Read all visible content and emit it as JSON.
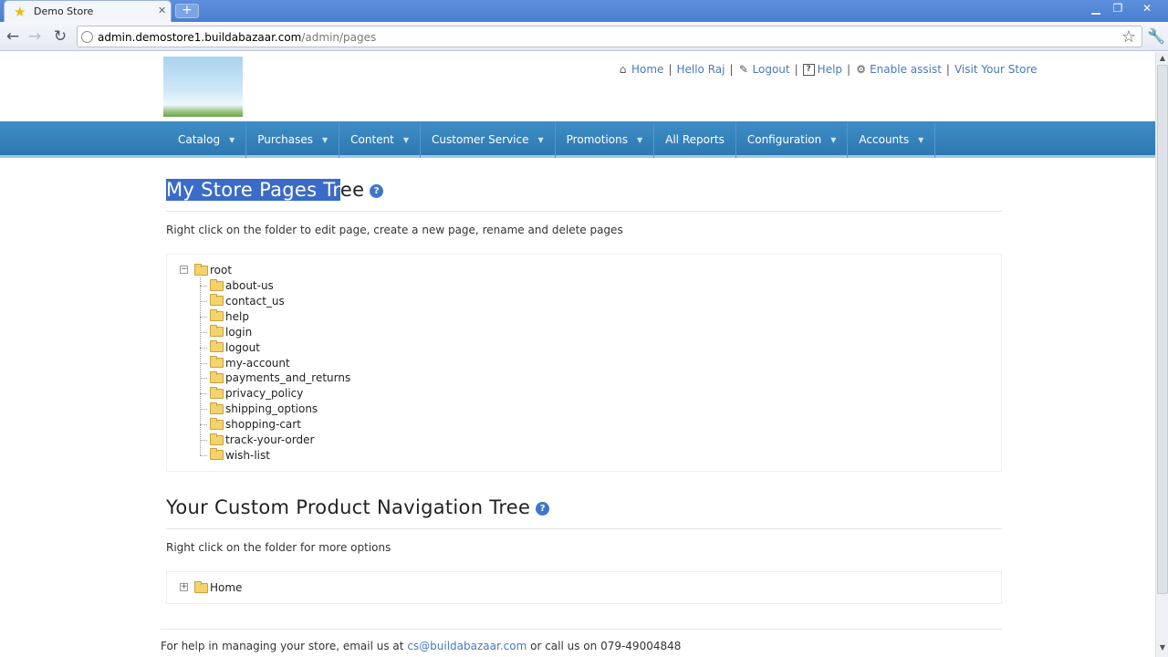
{
  "browser": {
    "tab_title": "Demo Store",
    "url_host": "admin.demostore1.buildabazaar.com",
    "url_path": "/admin/pages"
  },
  "header": {
    "links": {
      "home": "Home",
      "hello": "Hello Raj",
      "logout": "Logout",
      "help": "Help",
      "enable_assist": "Enable assist",
      "visit_store": "Visit Your Store"
    }
  },
  "menu": [
    {
      "label": "Catalog",
      "has_dropdown": true
    },
    {
      "label": "Purchases",
      "has_dropdown": true
    },
    {
      "label": "Content",
      "has_dropdown": true
    },
    {
      "label": "Customer Service",
      "has_dropdown": true
    },
    {
      "label": "Promotions",
      "has_dropdown": true
    },
    {
      "label": "All Reports",
      "has_dropdown": false
    },
    {
      "label": "Configuration",
      "has_dropdown": true
    },
    {
      "label": "Accounts",
      "has_dropdown": true
    }
  ],
  "pages_tree": {
    "title_selected": "My Store Pages Tr",
    "title_rest": "ee",
    "hint": "Right click on the folder to edit page, create a new page, rename and delete pages",
    "root": "root",
    "children": [
      "about-us",
      "contact_us",
      "help",
      "login",
      "logout",
      "my-account",
      "payments_and_returns",
      "privacy_policy",
      "shipping_options",
      "shopping-cart",
      "track-your-order",
      "wish-list"
    ]
  },
  "nav_tree": {
    "title": "Your Custom Product Navigation Tree",
    "hint": "Right click on the folder for more options",
    "root": "Home"
  },
  "footer": {
    "text_before": "For help in managing your store, email us at",
    "email": "cs@buildabazaar.com",
    "text_after": "or call us on 079-49004848"
  },
  "colors": {
    "menu_bar": "#3583bd",
    "link": "#4a79b8",
    "selection": "#3a6bc9"
  }
}
